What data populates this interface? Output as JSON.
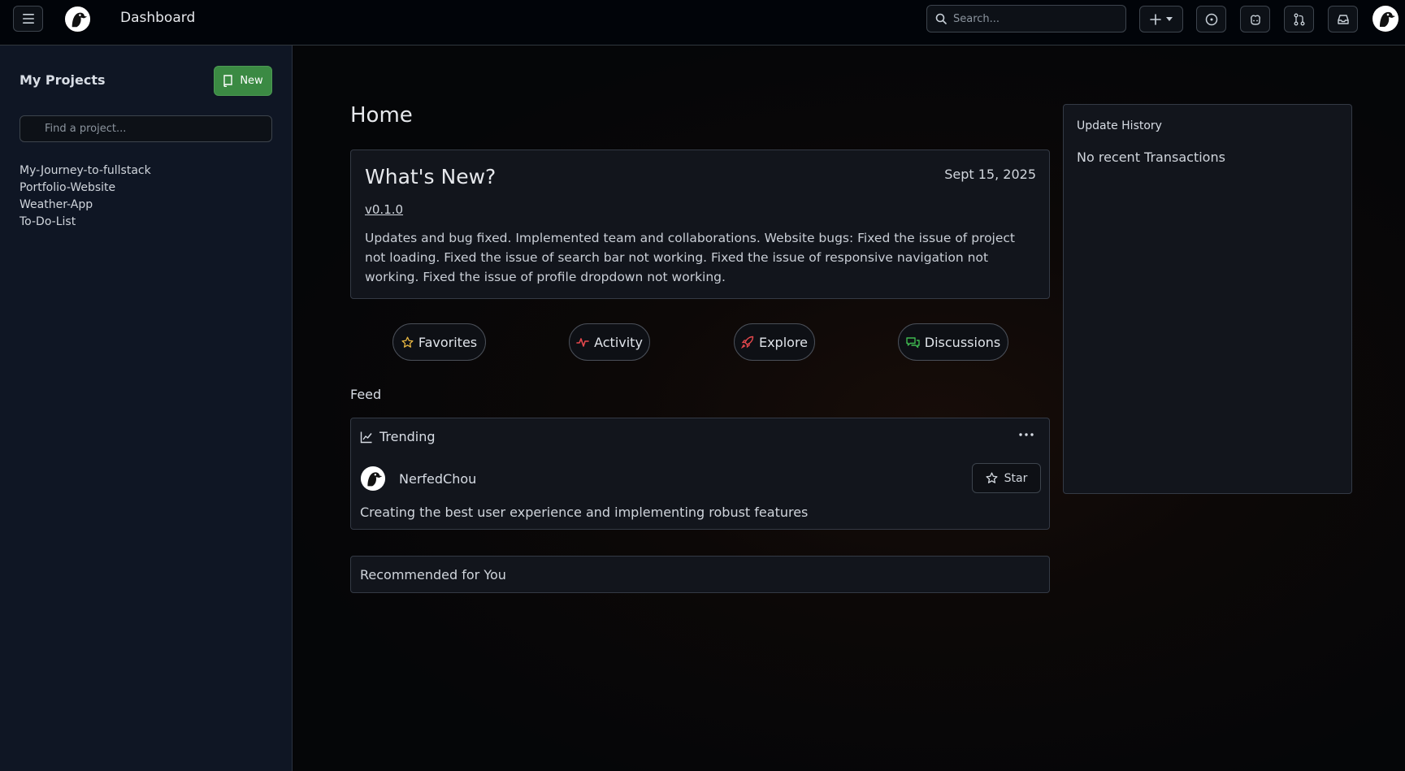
{
  "header": {
    "title": "Dashboard",
    "search_placeholder": "Search...",
    "icons": [
      "menu-icon",
      "app-logo",
      "search-icon",
      "plus-icon",
      "chevron-down-icon",
      "issues-icon",
      "copilot-icon",
      "pull-request-icon",
      "inbox-icon",
      "avatar"
    ]
  },
  "sidebar": {
    "title": "My Projects",
    "new_label": "New",
    "find_placeholder": "Find a project...",
    "projects": [
      {
        "label": "My-Journey-to-fullstack"
      },
      {
        "label": "Portfolio-Website"
      },
      {
        "label": "Weather-App"
      },
      {
        "label": "To-Do-List"
      }
    ]
  },
  "main": {
    "title": "Home",
    "whats_new": {
      "title": "What's New?",
      "date": "Sept 15, 2025",
      "version": "v0.1.0",
      "body": "Updates and bug fixed. Implemented team and collaborations. Website bugs: Fixed the issue of project not loading. Fixed the issue of search bar not working. Fixed the issue of responsive navigation not working. Fixed the issue of profile dropdown not working."
    },
    "pills": [
      {
        "label": "Favorites",
        "icon": "star-icon",
        "color": "#e3b341"
      },
      {
        "label": "Activity",
        "icon": "activity-icon",
        "color": "#e5484d"
      },
      {
        "label": "Explore",
        "icon": "rocket-icon",
        "color": "#e5484d"
      },
      {
        "label": "Discussions",
        "icon": "discussions-icon",
        "color": "#3fb950"
      }
    ],
    "feed": {
      "title": "Feed",
      "trending_label": "Trending",
      "username": "NerfedChou",
      "star_label": "Star",
      "description": "Creating the best user experience and implementing robust features"
    },
    "recommended_label": "Recommended for You"
  },
  "update_history": {
    "title": "Update History",
    "empty_text": "No recent Transactions"
  },
  "colors": {
    "accent_green": "#3b8a43",
    "background": "#050608",
    "sidebar_bg": "#0f1624",
    "border": "#343a45"
  }
}
